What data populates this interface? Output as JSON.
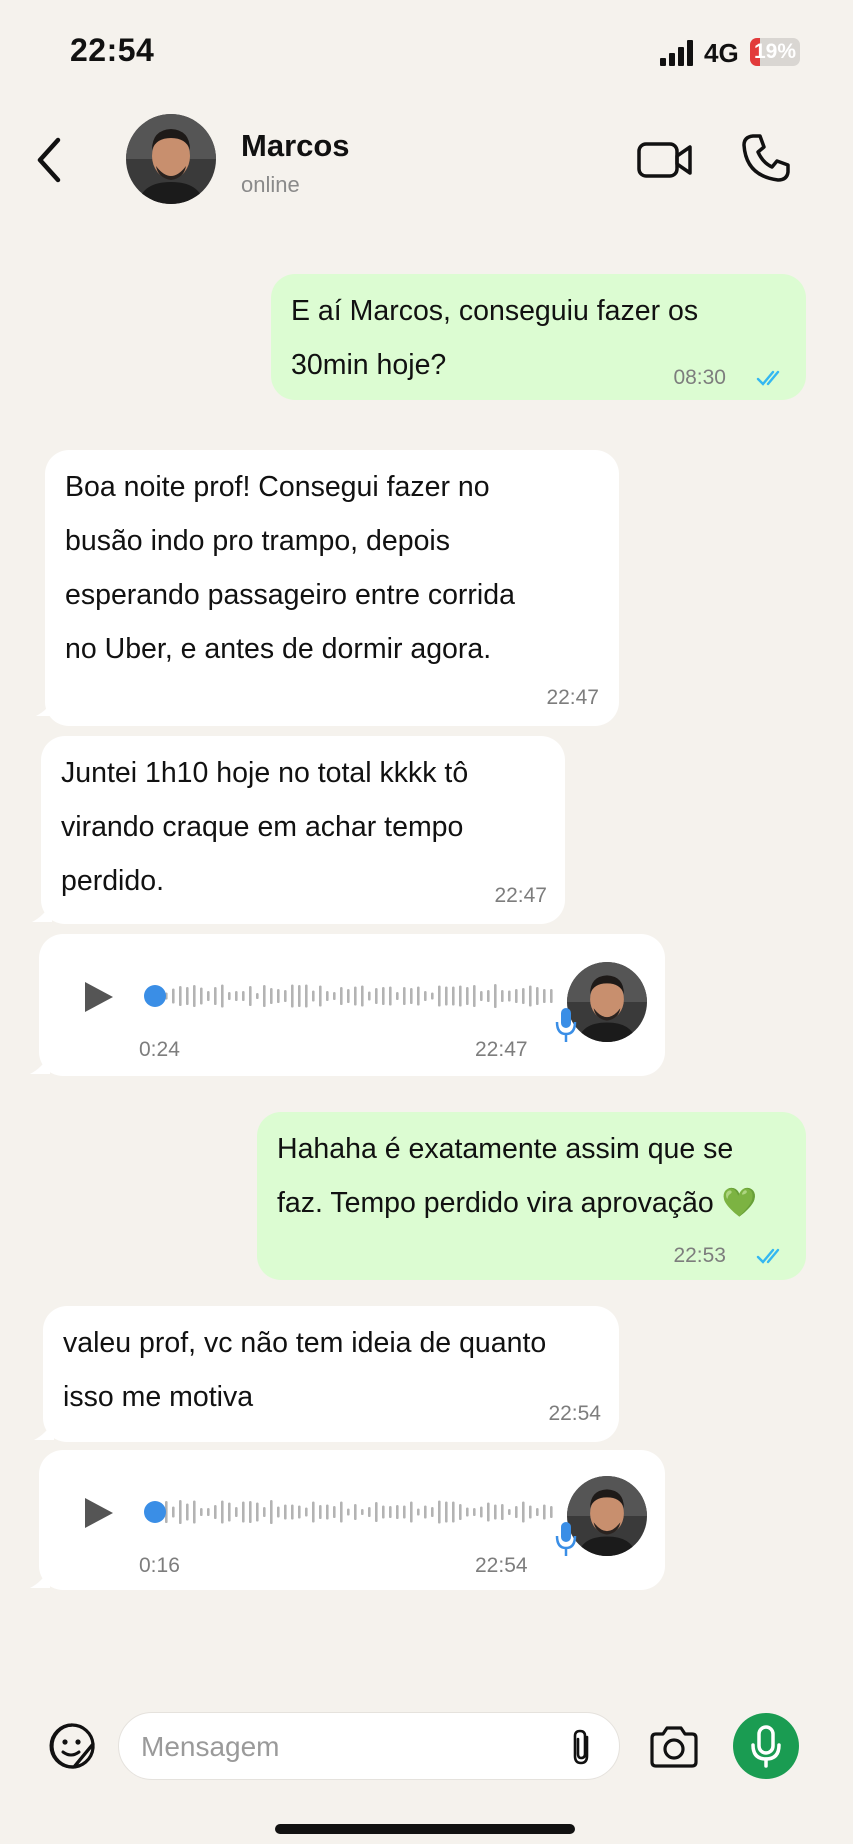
{
  "status_bar": {
    "time": "22:54",
    "network": "4G",
    "battery": "19%",
    "battery_level": 0.19
  },
  "header": {
    "name": "Marcos",
    "status": "online"
  },
  "messages": [
    {
      "dir": "out",
      "text": "E aí Marcos, conseguiu fazer os\n30min hoje?",
      "time": "08:30",
      "read": true
    },
    {
      "dir": "in",
      "text": "Boa noite prof! Consegui fazer no\nbusão indo pro trampo, depois\nesperando passageiro entre corrida\nno Uber, e antes de dormir agora.",
      "time": "22:47"
    },
    {
      "dir": "in",
      "text": "Juntei 1h10 hoje no total kkkk tô\nvirando craque em achar tempo\nperdido.",
      "time": "22:47"
    },
    {
      "dir": "in",
      "type": "voice",
      "duration": "0:24",
      "time": "22:47"
    },
    {
      "dir": "out",
      "text": "Hahaha é exatamente assim que se\nfaz. Tempo perdido vira aprovação 💚",
      "time": "22:53",
      "read": true
    },
    {
      "dir": "in",
      "text": "valeu prof, vc não tem ideia de quanto\nisso me motiva",
      "time": "22:54"
    },
    {
      "dir": "in",
      "type": "voice",
      "duration": "0:16",
      "time": "22:54"
    }
  ],
  "composer": {
    "placeholder": "Mensagem"
  },
  "colors": {
    "outgoing_bubble": "#dcfcd2",
    "incoming_bubble": "#ffffff",
    "accent_green": "#1a9c52",
    "tick_blue": "#34b7f1",
    "voice_dot": "#3a8ee6"
  },
  "icons": [
    "back-icon",
    "video-call-icon",
    "phone-icon",
    "play-icon",
    "mic-icon",
    "sticker-icon",
    "paperclip-icon",
    "camera-icon"
  ]
}
